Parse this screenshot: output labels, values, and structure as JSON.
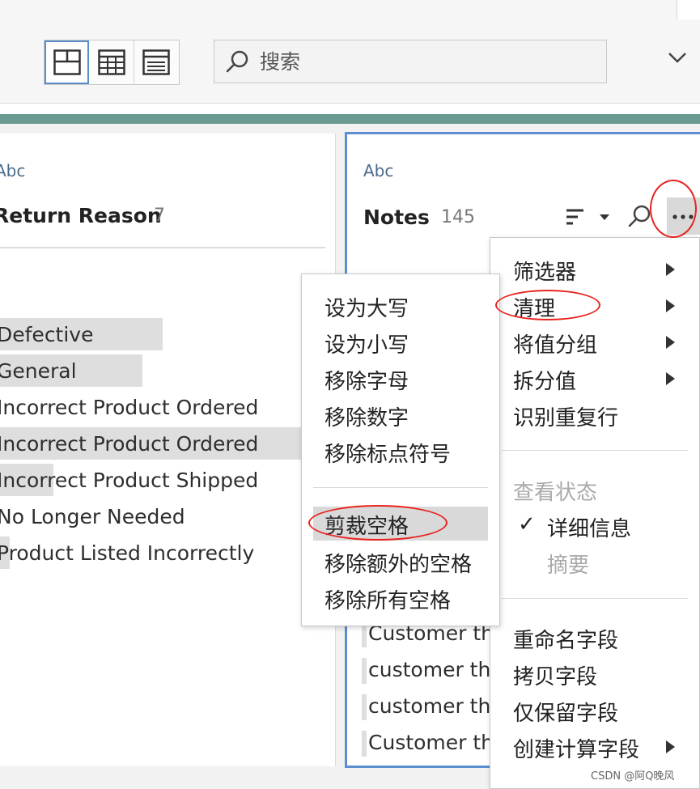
{
  "toolbar": {
    "view_buttons": [
      "profile-view",
      "table-view",
      "list-view"
    ],
    "search_placeholder": "搜索"
  },
  "fields": {
    "left": {
      "type": "Abc",
      "name": "Return Reason",
      "count": "7",
      "values": [
        {
          "label": "Defective",
          "share": 0.49
        },
        {
          "label": "General",
          "share": 0.43
        },
        {
          "label": "Incorrect Product Ordered",
          "share": 0.0
        },
        {
          "label": "Incorrect Product Ordered",
          "share": 1.0
        },
        {
          "label": "Incorrect Product Shipped",
          "share": 0.16
        },
        {
          "label": "No Longer Needed",
          "share": 0.0
        },
        {
          "label": "Product Listed Incorrectly",
          "share": 0.03
        }
      ]
    },
    "right": {
      "type": "Abc",
      "name": "Notes",
      "count": "145",
      "values": [
        "Customer th",
        "customer th",
        "customer th",
        "Customer th"
      ]
    }
  },
  "menu_main": {
    "items": [
      {
        "label": "筛选器",
        "submenu": true
      },
      {
        "label": "清理",
        "submenu": true
      },
      {
        "label": "将值分组",
        "submenu": true
      },
      {
        "label": "拆分值",
        "submenu": true
      },
      {
        "label": "识别重复行",
        "submenu": false
      }
    ],
    "view_state_header": "查看状态",
    "view_state_items": [
      {
        "label": "详细信息",
        "checked": true
      },
      {
        "label": "摘要",
        "checked": false
      }
    ],
    "field_items": [
      {
        "label": "重命名字段",
        "submenu": false
      },
      {
        "label": "拷贝字段",
        "submenu": false
      },
      {
        "label": "仅保留字段",
        "submenu": false
      },
      {
        "label": "创建计算字段",
        "submenu": true
      }
    ]
  },
  "menu_clean": {
    "items_a": [
      "设为大写",
      "设为小写",
      "移除字母",
      "移除数字",
      "移除标点符号"
    ],
    "items_b": [
      "剪裁空格",
      "移除额外的空格",
      "移除所有空格"
    ],
    "highlighted": "剪裁空格"
  },
  "colors": {
    "accent_blue": "#5b8fd0",
    "teal_bar": "#6a9a92",
    "annotation_red": "#e8231f"
  },
  "watermark": "CSDN @阿Q晚风"
}
